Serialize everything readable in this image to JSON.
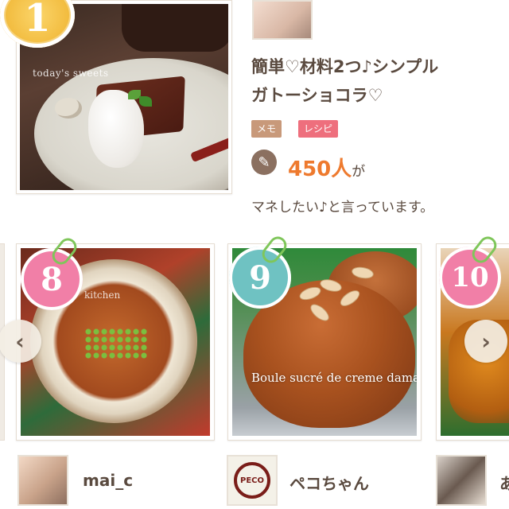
{
  "featured": {
    "rank": "1",
    "photo_caption": "today's sweets",
    "title_line1": "簡単♡材料2つ♪シンプル",
    "title_line2": "ガトーショコラ♡",
    "tags": [
      "メモ",
      "レシピ"
    ],
    "count": "450人",
    "count_suffix": "が",
    "mane_text": "マネしたい♪と言っています。"
  },
  "carousel": {
    "prev_arrow": "‹",
    "next_arrow": "›",
    "cards": [
      {
        "rank": "8",
        "photo_caption": "kitchen",
        "author": "mai_c"
      },
      {
        "rank": "9",
        "photo_caption": "Boule sucré de creme damande",
        "author": "ペコちゃん"
      },
      {
        "rank": "10",
        "photo_caption": "",
        "author": "あ"
      }
    ]
  },
  "colors": {
    "accent_orange": "#ee7a2e",
    "tag_memo": "#c8997a",
    "tag_recipe": "#ee6f7d",
    "rank_pink": "#f17fa7",
    "rank_teal": "#6fc2c2",
    "rank_gold": "#f1b93a",
    "clip_green": "#7fc65a"
  },
  "icons": {
    "mane": "pen-paper-icon",
    "prev": "chevron-left-icon",
    "next": "chevron-right-icon",
    "clip": "paperclip-icon"
  }
}
